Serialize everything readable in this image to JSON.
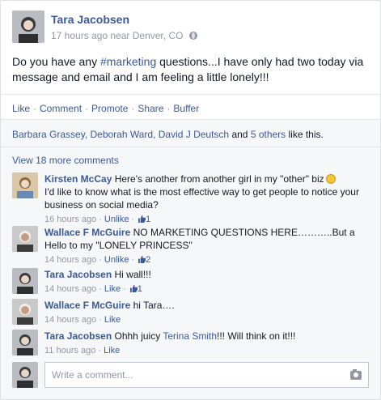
{
  "post": {
    "author": "Tara Jacobsen",
    "meta": "17 hours ago near Denver, CO",
    "text_before": "Do you have any ",
    "hashtag": "#marketing",
    "text_after": " questions...I have only had two today via message and email and I am feeling a little lonely!!!"
  },
  "actions": [
    "Like",
    "Comment",
    "Promote",
    "Share",
    "Buffer"
  ],
  "likes": {
    "names": "Barbara Grassey, Deborah Ward, David J Deutsch",
    "and": " and ",
    "others": "5 others",
    "suffix": " like this."
  },
  "view_more": "View 18 more comments",
  "comments": [
    {
      "author": "Kirsten McCay",
      "text": "Here's another from another girl in my \"other\" biz",
      "text2": "I'd like to know what is the most effective way to get people to notice your business on social media?",
      "time": "16 hours ago",
      "action": "Unlike",
      "likes": "1"
    },
    {
      "author": "Wallace F McGuire",
      "text": "NO MARKETING QUESTIONS HERE………..But a Hello to my \"LONELY PRINCESS\"",
      "time": "14 hours ago",
      "action": "Unlike",
      "likes": "2"
    },
    {
      "author": "Tara Jacobsen",
      "text": "Hi wall!!!",
      "time": "14 hours ago",
      "action": "Like",
      "likes": "1"
    },
    {
      "author": "Wallace F McGuire",
      "text": "hi Tara….",
      "time": "14 hours ago",
      "action": "Like"
    },
    {
      "author": "Tara Jacobsen",
      "text": "Ohhh juicy ",
      "mention": "Terina Smith",
      "text_after": "!!! Will think on it!!!",
      "time": "11 hours ago",
      "action": "Like"
    }
  ],
  "composer": {
    "placeholder": "Write a comment..."
  },
  "colors": {
    "link": "#3b5998",
    "meta": "#9197a3",
    "background": "#f6f7f8"
  },
  "icons": [
    "globe-icon",
    "smiley-icon",
    "thumbs-up-icon",
    "camera-icon"
  ]
}
